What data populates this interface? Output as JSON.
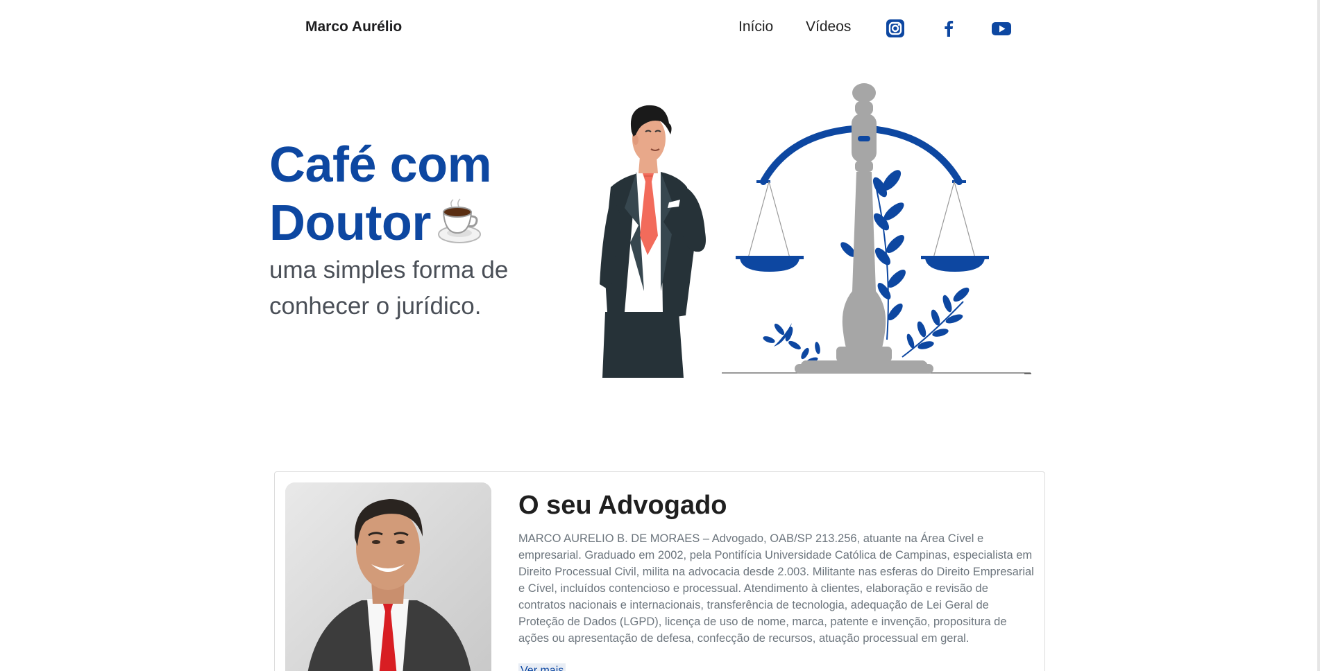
{
  "navbar": {
    "brand": "Marco Aurélio",
    "links": [
      {
        "label": "Início"
      },
      {
        "label": "Vídeos"
      }
    ],
    "social_icons": [
      "instagram-icon",
      "facebook-icon",
      "youtube-icon"
    ]
  },
  "hero": {
    "title_line1": "Café com",
    "title_line2": "Doutor",
    "title_emoji_icon": "coffee-cup-icon",
    "subtitle": "uma simples forma de conhecer o jurídico.",
    "illustration": "lawyer-with-scales-of-justice"
  },
  "about": {
    "title": "O seu Advogado",
    "text": "MARCO AURELIO B. DE MORAES – Advogado, OAB/SP 213.256, atuante na Área Cível e empresarial. Graduado em 2002, pela Pontifícia Universidade Católica de Campinas, especialista em Direito Processual Civil, milita na advocacia desde 2.003. Militante nas esferas do Direito Empresarial e Cível, incluídos contencioso e processual. Atendimento à clientes, elaboração e revisão de contratos nacionais e internacionais, transferência de tecnologia, adequação de Lei Geral de Proteção de Dados (LGPD), licença de uso de nome, marca, patente e invenção, propositura de ações ou apresentação de defesa, confecção de recursos, atuação processual em geral.",
    "more_label": "Ver mais"
  },
  "colors": {
    "primary": "#0d47a1",
    "text_muted": "#6c757d",
    "scale_gray": "#a6a6a6"
  }
}
